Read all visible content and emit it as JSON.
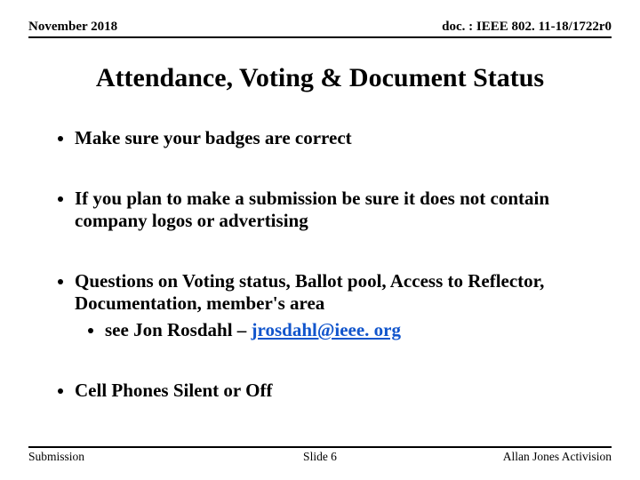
{
  "header": {
    "left": "November 2018",
    "right": "doc. : IEEE 802. 11-18/1722r0"
  },
  "title": "Attendance, Voting & Document Status",
  "bullets": {
    "b1": "Make sure your badges are correct",
    "b2": "If you plan to make a submission be sure it does not contain company logos or advertising",
    "b3": "Questions on Voting status, Ballot pool, Access to Reflector, Documentation,  member's area",
    "b3_sub_prefix": "see Jon Rosdahl –  ",
    "b3_sub_email": "jrosdahl@ieee. org",
    "b3_sub_email_href": "mailto:jrosdahl@ieee.org",
    "b4": "Cell Phones Silent or Off"
  },
  "footer": {
    "left": "Submission",
    "center": "Slide 6",
    "right": "Allan Jones Activision"
  }
}
